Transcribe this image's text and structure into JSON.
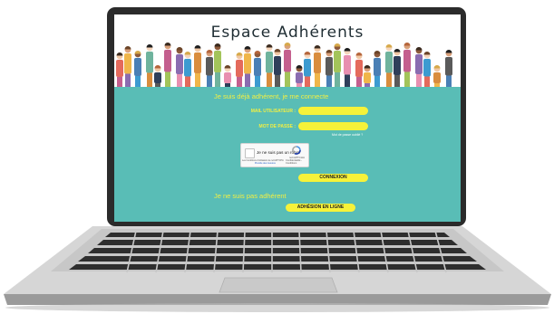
{
  "page": {
    "title": "Espace Adhérents",
    "member_heading": "Je suis déjà adhérent, je me connecte",
    "email_label": "MAIL UTILISATEUR :",
    "password_label": "MOT DE PASSE :",
    "forgot_link": "Mot de passe oublié ?",
    "email_value": "",
    "password_value": "",
    "captcha": {
      "label": "Je ne suis pas un robot",
      "brand": "reCAPTCHA",
      "terms": "Confidentialité - Conditions",
      "notice": "Les Conditions d'utilisation de reCAPTCHA ont changé.",
      "action": "Prendre des mesures"
    },
    "login_button": "CONNEXION",
    "nonmember_heading": "Je ne suis pas adhérent",
    "join_button": "ADHÉSION EN LIGNE"
  },
  "colors": {
    "teal": "#59bdb6",
    "yellow": "#f6f239",
    "label_yellow": "#f2ef43"
  }
}
